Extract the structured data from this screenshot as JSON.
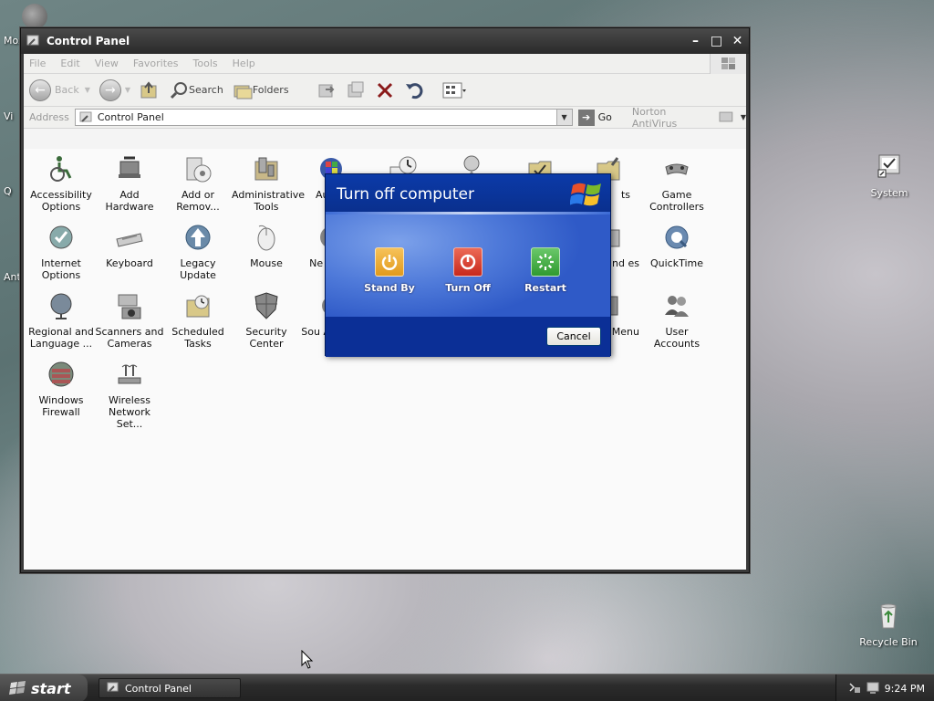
{
  "desktop": {
    "edge_labels": [
      "Moz",
      "Vi",
      "Q",
      "Ant"
    ],
    "icons": [
      {
        "label": "System",
        "icon": "system-icon"
      },
      {
        "label": "Recycle Bin",
        "icon": "recycle-bin-icon"
      }
    ]
  },
  "window": {
    "title": "Control Panel",
    "menu": [
      "File",
      "Edit",
      "View",
      "Favorites",
      "Tools",
      "Help"
    ],
    "toolbar": {
      "back": "Back",
      "search": "Search",
      "folders": "Folders"
    },
    "address": {
      "label": "Address",
      "value": "Control Panel",
      "go": "Go",
      "norton": "Norton AntiVirus"
    },
    "items": [
      {
        "label": "Accessibility Options",
        "icon": "accessibility-icon"
      },
      {
        "label": "Add Hardware",
        "icon": "add-hardware-icon"
      },
      {
        "label": "Add or Remov...",
        "icon": "add-remove-programs-icon"
      },
      {
        "label": "Administrative Tools",
        "icon": "administrative-tools-icon"
      },
      {
        "label": "Au Up",
        "icon": "automatic-updates-icon"
      },
      {
        "label": "",
        "icon": "date-time-icon"
      },
      {
        "label": "",
        "icon": "display-icon"
      },
      {
        "label": "",
        "icon": "folder-options-icon"
      },
      {
        "label": "ts",
        "icon": "fonts-icon"
      },
      {
        "label": "Game Controllers",
        "icon": "game-controllers-icon"
      },
      {
        "label": "Internet Options",
        "icon": "internet-options-icon"
      },
      {
        "label": "Keyboard",
        "icon": "keyboard-icon"
      },
      {
        "label": "Legacy Update",
        "icon": "legacy-update-icon"
      },
      {
        "label": "Mouse",
        "icon": "mouse-icon"
      },
      {
        "label": "Ne Con",
        "icon": "network-connections-icon"
      },
      {
        "label": "and es",
        "icon": "phone-modem-icon"
      },
      {
        "label": "QuickTime",
        "icon": "quicktime-icon"
      },
      {
        "label": "Regional and Language ...",
        "icon": "regional-language-icon"
      },
      {
        "label": "Scanners and Cameras",
        "icon": "scanners-cameras-icon"
      },
      {
        "label": "Scheduled Tasks",
        "icon": "scheduled-tasks-icon"
      },
      {
        "label": "Security Center",
        "icon": "security-center-icon"
      },
      {
        "label": "Sou Audi",
        "icon": "sounds-audio-icon"
      },
      {
        "label": "r and Menu",
        "icon": "taskbar-start-menu-icon"
      },
      {
        "label": "User Accounts",
        "icon": "user-accounts-icon"
      },
      {
        "label": "Windows Firewall",
        "icon": "windows-firewall-icon"
      },
      {
        "label": "Wireless Network Set...",
        "icon": "wireless-network-icon"
      }
    ]
  },
  "dialog": {
    "title": "Turn off computer",
    "options": [
      {
        "label": "Stand By",
        "color": "#e8a325",
        "icon": "standby-icon"
      },
      {
        "label": "Turn Off",
        "color": "#d4362a",
        "icon": "power-icon"
      },
      {
        "label": "Restart",
        "color": "#3aa53a",
        "icon": "restart-icon"
      }
    ],
    "cancel": "Cancel"
  },
  "taskbar": {
    "start": "start",
    "task": "Control Panel",
    "clock": "9:24 PM"
  }
}
